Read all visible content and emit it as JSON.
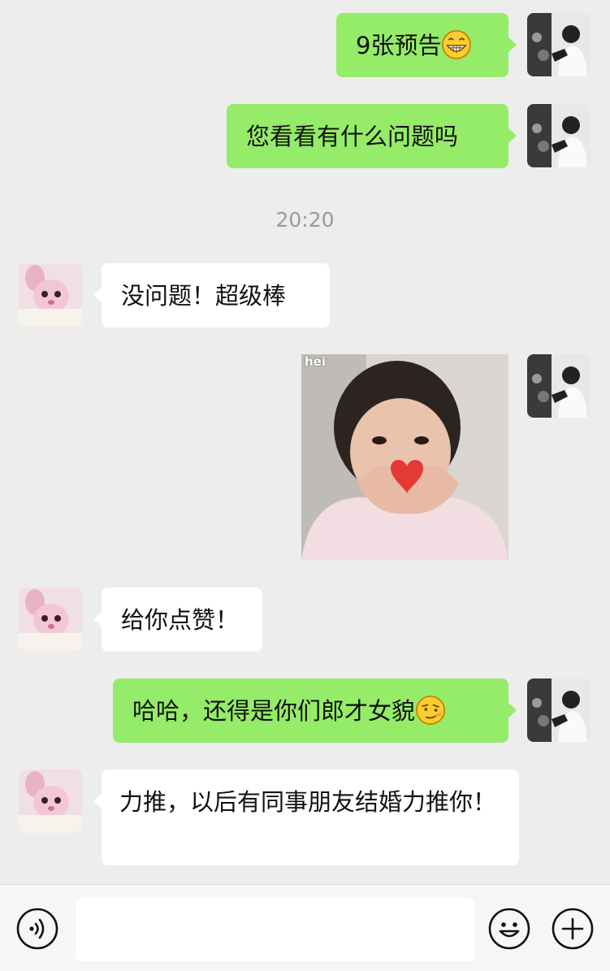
{
  "messages": [
    {
      "side": "out",
      "text": "9张预告",
      "emoji": "grin-emoji"
    },
    {
      "side": "out",
      "text": "您看看有什么问题吗"
    },
    {
      "type": "time",
      "text": "20:20"
    },
    {
      "side": "in",
      "text": "没问题！超级棒"
    },
    {
      "side": "out",
      "type": "image",
      "tag": "hei",
      "description_icon": "heart-hands-photo"
    },
    {
      "side": "in",
      "text": "给你点赞！"
    },
    {
      "side": "out",
      "text": "哈哈，还得是你们郎才女貌",
      "emoji": "smirk-emoji"
    },
    {
      "side": "in",
      "text": "力推，以后有同事朋友结婚力推你！"
    }
  ],
  "input_bar": {
    "voice_icon": "voice-icon",
    "emoji_icon": "emoji-icon",
    "plus_icon": "plus-icon",
    "input_value": ""
  },
  "colors": {
    "background": "#ededed",
    "outgoing_bubble": "#95ec69",
    "incoming_bubble": "#ffffff",
    "timestamp": "#9a9a9a"
  }
}
